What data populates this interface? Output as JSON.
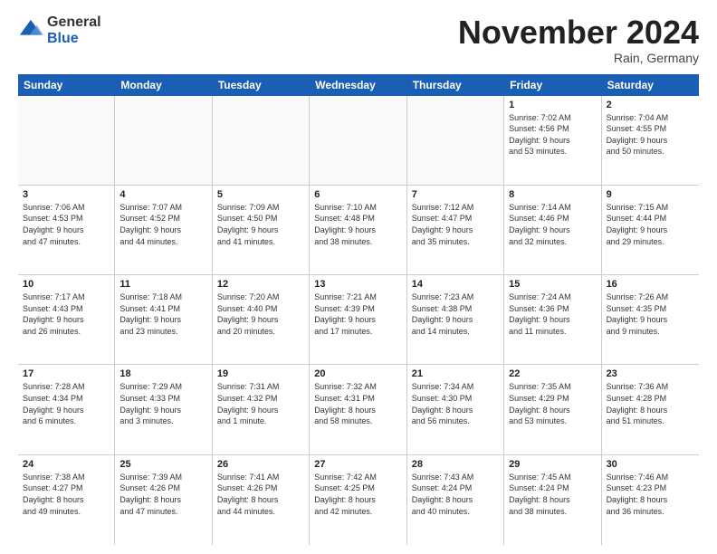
{
  "header": {
    "logo_general": "General",
    "logo_blue": "Blue",
    "month_title": "November 2024",
    "location": "Rain, Germany"
  },
  "calendar": {
    "days_of_week": [
      "Sunday",
      "Monday",
      "Tuesday",
      "Wednesday",
      "Thursday",
      "Friday",
      "Saturday"
    ],
    "weeks": [
      [
        {
          "day": "",
          "info": "",
          "empty": true
        },
        {
          "day": "",
          "info": "",
          "empty": true
        },
        {
          "day": "",
          "info": "",
          "empty": true
        },
        {
          "day": "",
          "info": "",
          "empty": true
        },
        {
          "day": "",
          "info": "",
          "empty": true
        },
        {
          "day": "1",
          "info": "Sunrise: 7:02 AM\nSunset: 4:56 PM\nDaylight: 9 hours\nand 53 minutes.",
          "empty": false
        },
        {
          "day": "2",
          "info": "Sunrise: 7:04 AM\nSunset: 4:55 PM\nDaylight: 9 hours\nand 50 minutes.",
          "empty": false
        }
      ],
      [
        {
          "day": "3",
          "info": "Sunrise: 7:06 AM\nSunset: 4:53 PM\nDaylight: 9 hours\nand 47 minutes.",
          "empty": false
        },
        {
          "day": "4",
          "info": "Sunrise: 7:07 AM\nSunset: 4:52 PM\nDaylight: 9 hours\nand 44 minutes.",
          "empty": false
        },
        {
          "day": "5",
          "info": "Sunrise: 7:09 AM\nSunset: 4:50 PM\nDaylight: 9 hours\nand 41 minutes.",
          "empty": false
        },
        {
          "day": "6",
          "info": "Sunrise: 7:10 AM\nSunset: 4:48 PM\nDaylight: 9 hours\nand 38 minutes.",
          "empty": false
        },
        {
          "day": "7",
          "info": "Sunrise: 7:12 AM\nSunset: 4:47 PM\nDaylight: 9 hours\nand 35 minutes.",
          "empty": false
        },
        {
          "day": "8",
          "info": "Sunrise: 7:14 AM\nSunset: 4:46 PM\nDaylight: 9 hours\nand 32 minutes.",
          "empty": false
        },
        {
          "day": "9",
          "info": "Sunrise: 7:15 AM\nSunset: 4:44 PM\nDaylight: 9 hours\nand 29 minutes.",
          "empty": false
        }
      ],
      [
        {
          "day": "10",
          "info": "Sunrise: 7:17 AM\nSunset: 4:43 PM\nDaylight: 9 hours\nand 26 minutes.",
          "empty": false
        },
        {
          "day": "11",
          "info": "Sunrise: 7:18 AM\nSunset: 4:41 PM\nDaylight: 9 hours\nand 23 minutes.",
          "empty": false
        },
        {
          "day": "12",
          "info": "Sunrise: 7:20 AM\nSunset: 4:40 PM\nDaylight: 9 hours\nand 20 minutes.",
          "empty": false
        },
        {
          "day": "13",
          "info": "Sunrise: 7:21 AM\nSunset: 4:39 PM\nDaylight: 9 hours\nand 17 minutes.",
          "empty": false
        },
        {
          "day": "14",
          "info": "Sunrise: 7:23 AM\nSunset: 4:38 PM\nDaylight: 9 hours\nand 14 minutes.",
          "empty": false
        },
        {
          "day": "15",
          "info": "Sunrise: 7:24 AM\nSunset: 4:36 PM\nDaylight: 9 hours\nand 11 minutes.",
          "empty": false
        },
        {
          "day": "16",
          "info": "Sunrise: 7:26 AM\nSunset: 4:35 PM\nDaylight: 9 hours\nand 9 minutes.",
          "empty": false
        }
      ],
      [
        {
          "day": "17",
          "info": "Sunrise: 7:28 AM\nSunset: 4:34 PM\nDaylight: 9 hours\nand 6 minutes.",
          "empty": false
        },
        {
          "day": "18",
          "info": "Sunrise: 7:29 AM\nSunset: 4:33 PM\nDaylight: 9 hours\nand 3 minutes.",
          "empty": false
        },
        {
          "day": "19",
          "info": "Sunrise: 7:31 AM\nSunset: 4:32 PM\nDaylight: 9 hours\nand 1 minute.",
          "empty": false
        },
        {
          "day": "20",
          "info": "Sunrise: 7:32 AM\nSunset: 4:31 PM\nDaylight: 8 hours\nand 58 minutes.",
          "empty": false
        },
        {
          "day": "21",
          "info": "Sunrise: 7:34 AM\nSunset: 4:30 PM\nDaylight: 8 hours\nand 56 minutes.",
          "empty": false
        },
        {
          "day": "22",
          "info": "Sunrise: 7:35 AM\nSunset: 4:29 PM\nDaylight: 8 hours\nand 53 minutes.",
          "empty": false
        },
        {
          "day": "23",
          "info": "Sunrise: 7:36 AM\nSunset: 4:28 PM\nDaylight: 8 hours\nand 51 minutes.",
          "empty": false
        }
      ],
      [
        {
          "day": "24",
          "info": "Sunrise: 7:38 AM\nSunset: 4:27 PM\nDaylight: 8 hours\nand 49 minutes.",
          "empty": false
        },
        {
          "day": "25",
          "info": "Sunrise: 7:39 AM\nSunset: 4:26 PM\nDaylight: 8 hours\nand 47 minutes.",
          "empty": false
        },
        {
          "day": "26",
          "info": "Sunrise: 7:41 AM\nSunset: 4:26 PM\nDaylight: 8 hours\nand 44 minutes.",
          "empty": false
        },
        {
          "day": "27",
          "info": "Sunrise: 7:42 AM\nSunset: 4:25 PM\nDaylight: 8 hours\nand 42 minutes.",
          "empty": false
        },
        {
          "day": "28",
          "info": "Sunrise: 7:43 AM\nSunset: 4:24 PM\nDaylight: 8 hours\nand 40 minutes.",
          "empty": false
        },
        {
          "day": "29",
          "info": "Sunrise: 7:45 AM\nSunset: 4:24 PM\nDaylight: 8 hours\nand 38 minutes.",
          "empty": false
        },
        {
          "day": "30",
          "info": "Sunrise: 7:46 AM\nSunset: 4:23 PM\nDaylight: 8 hours\nand 36 minutes.",
          "empty": false
        }
      ]
    ]
  }
}
